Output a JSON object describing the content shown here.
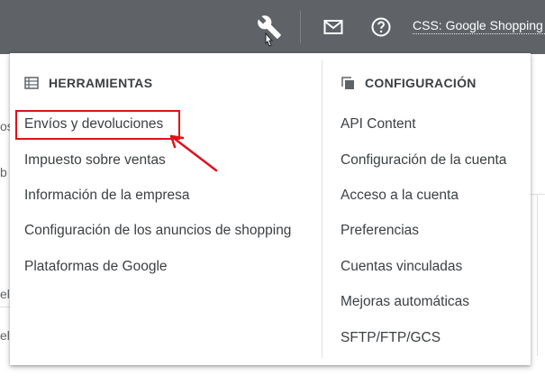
{
  "topbar": {
    "account_label": "CSS: Google Shopping (go"
  },
  "icons": {
    "tools": "wrench-icon",
    "mail": "mail-icon",
    "help": "help-icon"
  },
  "background_fragments": [
    "os",
    "b",
    "el",
    "el"
  ],
  "menu": {
    "left": {
      "header": "HERRAMIENTAS",
      "items": [
        "Envíos y devoluciones",
        "Impuesto sobre ventas",
        "Información de la empresa",
        "Configuración de los anuncios de shopping",
        "Plataformas de Google"
      ]
    },
    "right": {
      "header": "CONFIGURACIÓN",
      "items": [
        "API Content",
        "Configuración de la cuenta",
        "Acceso a la cuenta",
        "Preferencias",
        "Cuentas vinculadas",
        "Mejoras automáticas",
        "SFTP/FTP/GCS"
      ]
    }
  },
  "colors": {
    "topbar": "#5f6368",
    "highlight": "#e0111c",
    "text": "#3c4043"
  }
}
